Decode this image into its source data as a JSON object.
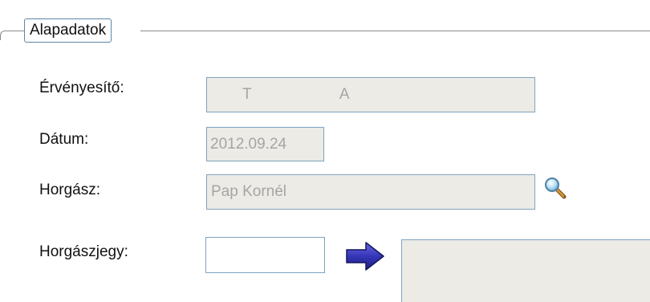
{
  "group": {
    "legend": "Alapadatok"
  },
  "fields": {
    "ervenyesito": {
      "label": "Érvényesítő:",
      "value_first": "T",
      "value_second": "A"
    },
    "datum": {
      "label": "Dátum:",
      "value": "2012.09.24"
    },
    "horgasz": {
      "label": "Horgász:",
      "value": "Pap Kornél"
    },
    "horgaszjegy": {
      "label": "Horgászjegy:",
      "value": ""
    }
  },
  "icons": {
    "search": "search-icon",
    "arrow": "arrow-right-icon"
  },
  "colors": {
    "field_border": "#7fa3c0",
    "readonly_bg": "#ecebe6",
    "readonly_text": "#a5a5a5",
    "arrow_fill": "#3c3ca8"
  }
}
